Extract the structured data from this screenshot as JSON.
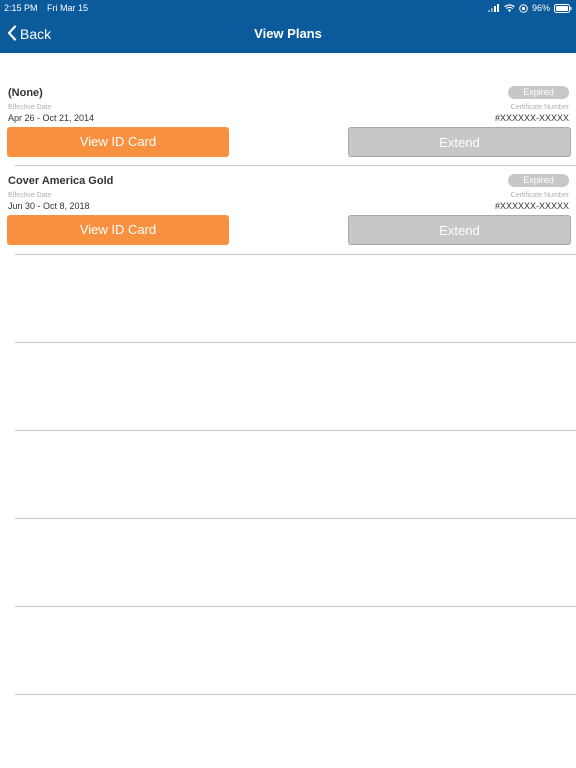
{
  "status_bar": {
    "time": "2:15 PM",
    "date": "Fri Mar 15",
    "battery": "96%"
  },
  "nav": {
    "back_label": "Back",
    "title": "View Plans"
  },
  "plans": [
    {
      "name": "(None)",
      "status": "Expired",
      "effective_label": "Effective Date",
      "effective_value": "Apr 26 - Oct 21, 2014",
      "certificate_label": "Certificate Number",
      "certificate_value": "#XXXXXX-XXXXX",
      "view_button": "View ID Card",
      "extend_button": "Extend"
    },
    {
      "name": "Cover America Gold",
      "status": "Expired",
      "effective_label": "Effective Date",
      "effective_value": "Jun 30 - Oct 8, 2018",
      "certificate_label": "Certificate Number",
      "certificate_value": "#XXXXXX-XXXXX",
      "view_button": "View ID Card",
      "extend_button": "Extend"
    }
  ],
  "colors": {
    "nav_background": "#0b5a9c",
    "primary_button": "#f7913f",
    "disabled_button": "#c7c7c7"
  }
}
